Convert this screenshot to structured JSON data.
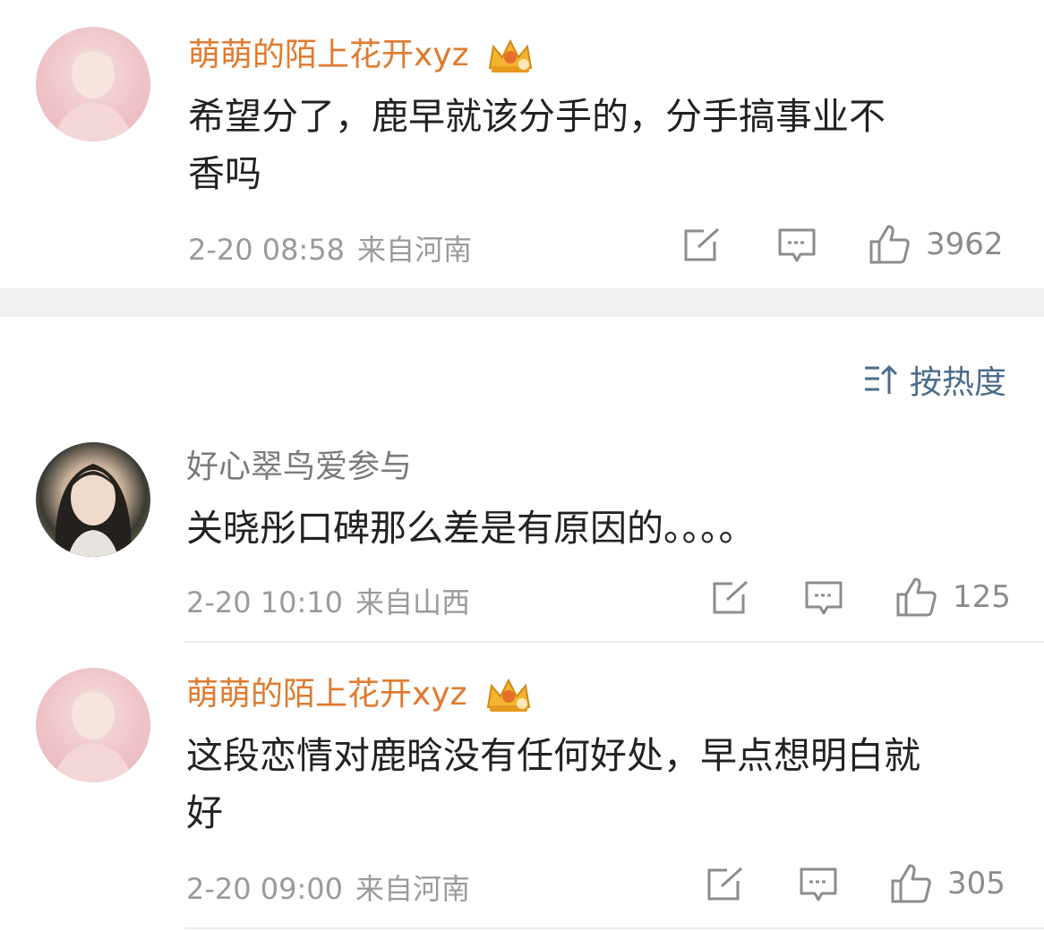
{
  "comments": [
    {
      "username": "萌萌的陌上花开xyz",
      "username_color": "#e07a2f",
      "has_crown_badge": true,
      "text_lines": [
        "希望分了，鹿早就该分手的，分手搞事业不",
        "香吗"
      ],
      "date": "2-20 08:58",
      "location": "来自河南",
      "likes": "3962"
    },
    {
      "username": "好心翠鸟爱参与",
      "username_color": "#7a7a7a",
      "has_crown_badge": false,
      "text_lines": [
        "关晓彤口碑那么差是有原因的。。。。"
      ],
      "date": "2-20 10:10",
      "location": "来自山西",
      "likes": "125"
    },
    {
      "username": "萌萌的陌上花开xyz",
      "username_color": "#e07a2f",
      "has_crown_badge": true,
      "text_lines": [
        "这段恋情对鹿晗没有任何好处，早点想明白就",
        "好"
      ],
      "date": "2-20 09:00",
      "location": "来自河南",
      "likes": "305"
    }
  ],
  "sort": {
    "label": "按热度",
    "icon": "sort-icon"
  },
  "icons": {
    "share": "share-icon",
    "reply": "comment-icon",
    "like": "thumbs-up-icon",
    "badge": "crown-badge-icon"
  },
  "colors": {
    "accent_orange": "#e07a2f",
    "sort_blue": "#4a6c8c",
    "meta_gray": "#9a9a9a"
  }
}
